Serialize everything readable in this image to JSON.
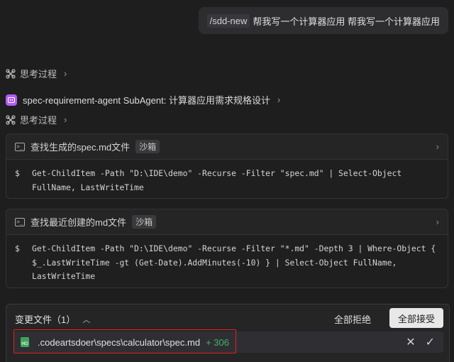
{
  "user_message": {
    "command": "/sdd-new",
    "text": "帮我写一个计算器应用 帮我写一个计算器应用"
  },
  "thinking_1": {
    "label": "思考过程"
  },
  "subagent": {
    "label": "spec-requirement-agent SubAgent: 计算器应用需求规格设计"
  },
  "thinking_2": {
    "label": "思考过程"
  },
  "tool_cards": [
    {
      "title": "查找生成的spec.md文件",
      "badge": "沙箱",
      "prompt": "$",
      "command": "Get-ChildItem -Path \"D:\\IDE\\demo\" -Recurse -Filter \"spec.md\" | Select-Object FullName, LastWriteTime"
    },
    {
      "title": "查找最近创建的md文件",
      "badge": "沙箱",
      "prompt": "$",
      "command": "Get-ChildItem -Path \"D:\\IDE\\demo\" -Recurse -Filter \"*.md\" -Depth 3 | Where-Object { $_.LastWriteTime -gt (Get-Date).AddMinutes(-10) } | Select-Object FullName, LastWriteTime"
    }
  ],
  "changes": {
    "title": "变更文件（1）",
    "reject_all": "全部拒绝",
    "accept_all": "全部接受",
    "files": [
      {
        "path": ".codeartsdoer\\specs\\calculator\\spec.md",
        "additions": "+ 306",
        "icon_label": "MD"
      }
    ]
  },
  "colors": {
    "background": "#1e1e1e",
    "agent_icon": "#b15cf3",
    "addition": "#3fb36a",
    "md_icon": "#3fa45b",
    "highlight": "#e02020"
  },
  "icons": {
    "thinking": "brain-icon",
    "agent": "agent-icon",
    "terminal": "terminal-icon",
    "chevron": "chevron-right-icon",
    "collapse": "chevron-up-icon",
    "file": "markdown-file-icon",
    "discard": "close-icon",
    "accept": "check-icon"
  }
}
